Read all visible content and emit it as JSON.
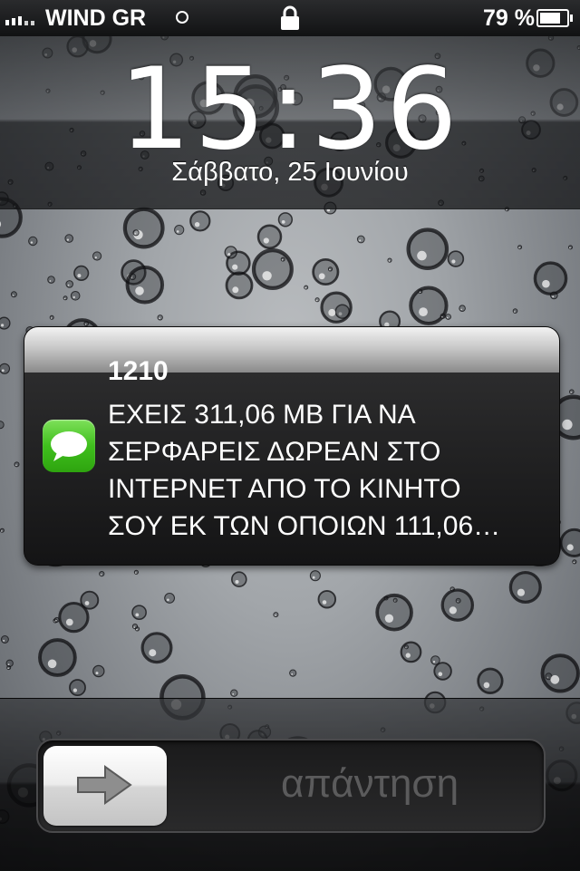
{
  "status_bar": {
    "carrier": "WIND GR",
    "battery_percent": "79 %",
    "battery_level": 0.79,
    "signal_bars": 5,
    "icons": [
      "signal-icon",
      "wifi-icon",
      "lock-icon",
      "battery-icon"
    ]
  },
  "lock_screen": {
    "time": "15:36",
    "date": "Σάββατο, 25 Ιουνίου"
  },
  "notification": {
    "app_icon": "messages-icon",
    "app_icon_color": "#3fbf1d",
    "sender": "1210",
    "message": "ΕΧΕΙΣ 311,06 MB ΓΙΑ ΝΑ\nΣΕΡΦΑΡΕΙΣ ΔΩΡΕΑΝ ΣΤΟ\nΙΝΤΕΡΝΕΤ ΑΠΟ ΤΟ ΚΙΝΗΤΟ\nΣΟΥ ΕΚ ΤΩΝ ΟΠΟΙΩΝ 111,06…"
  },
  "unlock_slider": {
    "label": "απάντηση",
    "knob_icon": "arrow-right-icon"
  }
}
